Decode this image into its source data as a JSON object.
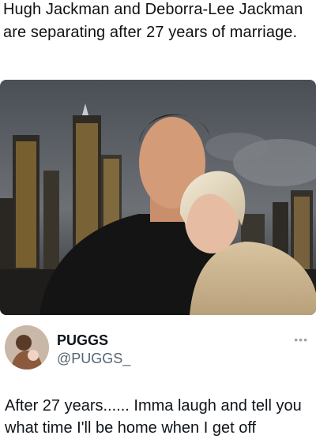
{
  "headline": "Hugh Jackman and Deborra-Lee Jackman are separating after 27 years of marriage.",
  "tweet": {
    "display_name": "PUGGS",
    "handle": "@PUGGS_",
    "more_icon": "more-dots-icon",
    "text": "After 27 years...... Imma laugh and tell you what time I'll be home when I get off"
  }
}
